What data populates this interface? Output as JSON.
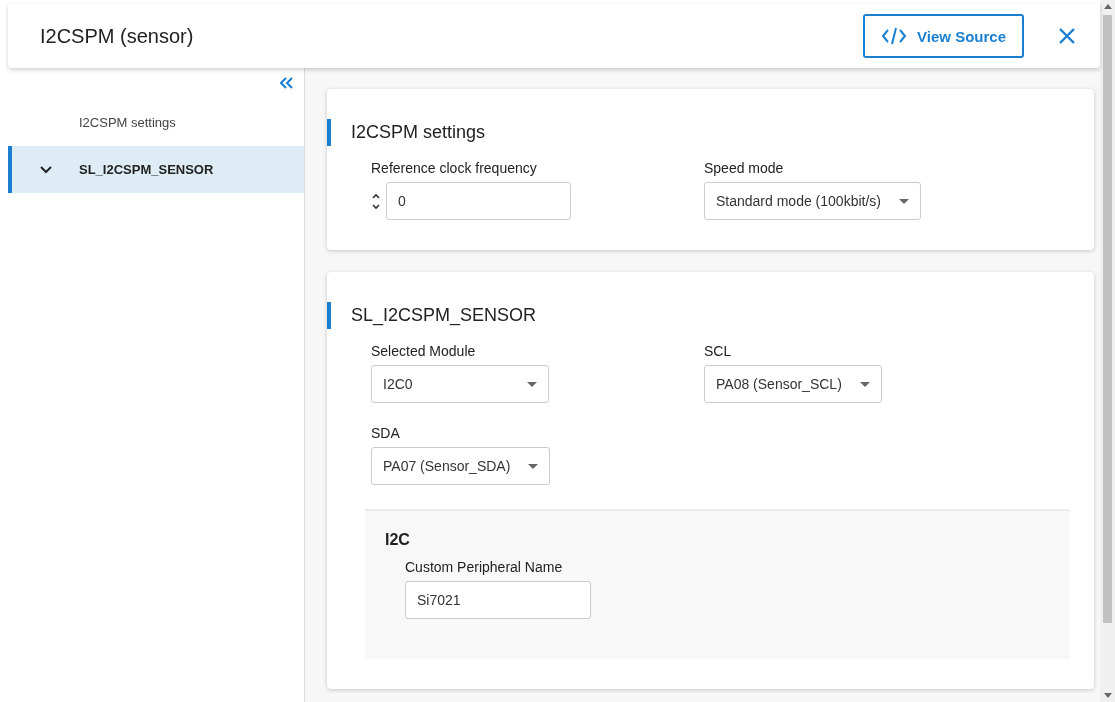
{
  "window": {
    "title": "I2CSPM (sensor)"
  },
  "header": {
    "view_source": "View Source"
  },
  "sidebar": {
    "items": [
      {
        "label": "I2CSPM settings",
        "kind": "leaf",
        "selected": false
      },
      {
        "label": "SL_I2CSPM_SENSOR",
        "kind": "group",
        "selected": true,
        "expanded": true
      }
    ]
  },
  "sections": [
    {
      "title": "I2CSPM settings",
      "fields": [
        {
          "kind": "number",
          "label": "Reference clock frequency",
          "value": "0"
        },
        {
          "kind": "select",
          "label": "Speed mode",
          "value": "Standard mode (100kbit/s)"
        }
      ]
    },
    {
      "title": "SL_I2CSPM_SENSOR",
      "fields": [
        {
          "kind": "select",
          "label": "Selected Module",
          "value": "I2C0"
        },
        {
          "kind": "select",
          "label": "SCL",
          "value": "PA08 (Sensor_SCL)"
        },
        {
          "kind": "select",
          "label": "SDA",
          "value": "PA07 (Sensor_SDA)"
        }
      ],
      "subsections": [
        {
          "title": "I2C",
          "fields": [
            {
              "kind": "text",
              "label": "Custom Peripheral Name",
              "value": "Si7021"
            }
          ]
        }
      ]
    }
  ]
}
